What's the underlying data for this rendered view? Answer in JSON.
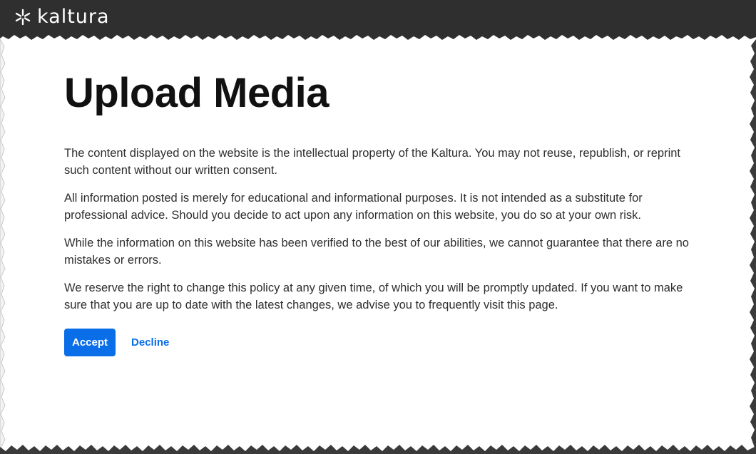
{
  "brand": {
    "logo_icon": "kaltura-logo-icon",
    "logo_text": "kaltura",
    "header_color": "#2f2f2f"
  },
  "main": {
    "title": "Upload Media",
    "paragraphs": [
      "The content displayed on the website is the intellectual property of the Kaltura. You may not reuse, republish, or reprint such content without our written consent.",
      "All information posted is merely for educational and informational purposes. It is not intended as a substitute for professional advice. Should you decide to act upon any information on this website, you do so at your own risk.",
      "While the information on this website has been verified to the best of our abilities, we cannot guarantee that there are no mistakes or errors.",
      "We reserve the right to change this policy at any given time, of which you will be promptly updated. If you want to make sure that you are up to date with the latest changes, we advise you to frequently visit this page."
    ]
  },
  "actions": {
    "accept_label": "Accept",
    "decline_label": "Decline",
    "accent_color": "#0a6ee8"
  }
}
